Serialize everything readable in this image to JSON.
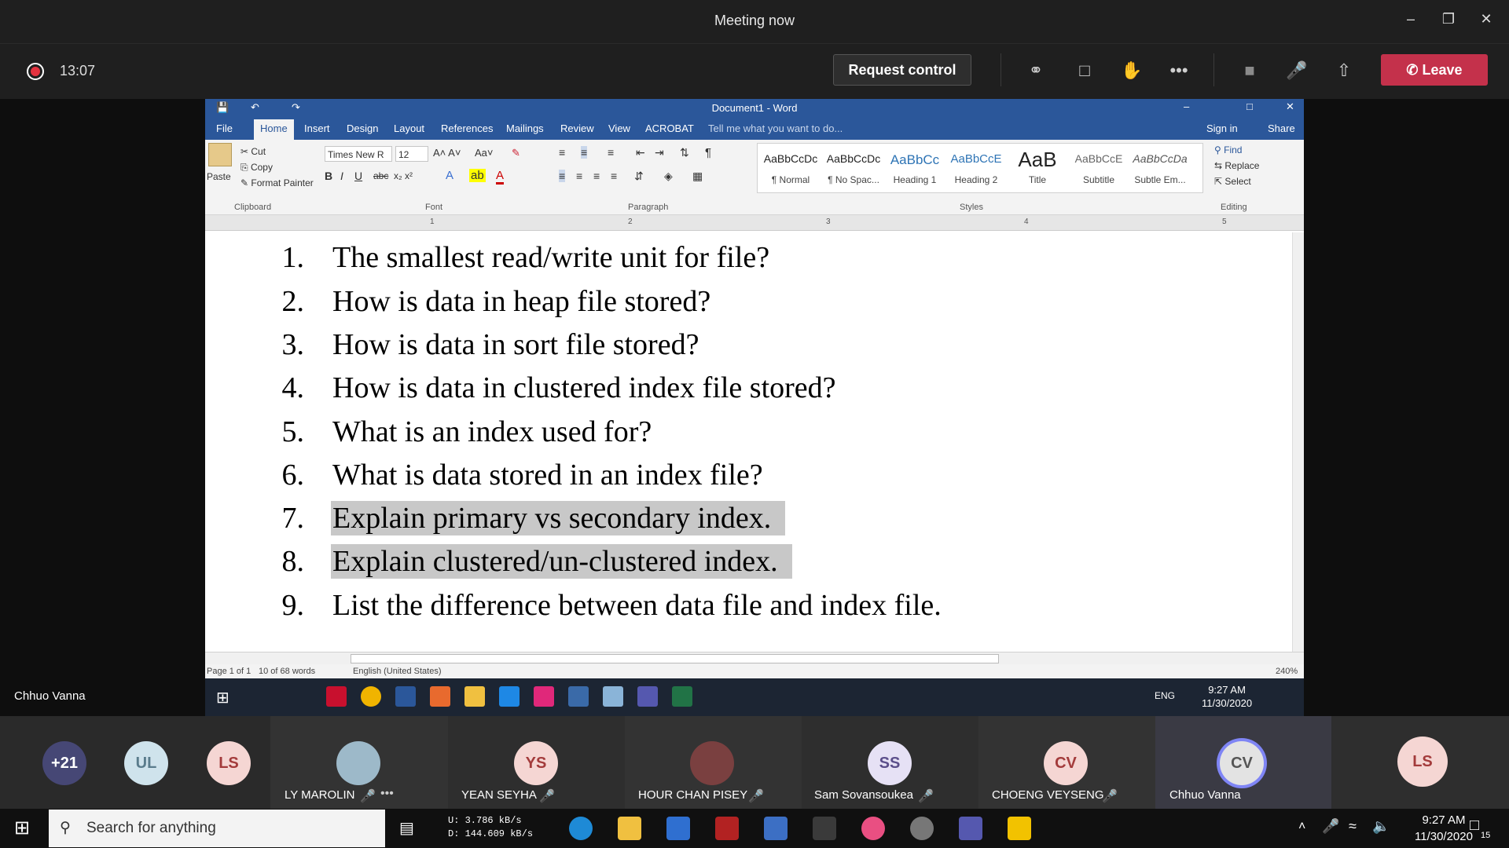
{
  "teams": {
    "window_title": "Meeting now",
    "timer": "13:07",
    "request_control": "Request control",
    "leave": "Leave",
    "presenter_label": "Chhuo Vanna"
  },
  "word": {
    "doc_title": "Document1 - Word",
    "tabs": [
      "File",
      "Home",
      "Insert",
      "Design",
      "Layout",
      "References",
      "Mailings",
      "Review",
      "View",
      "ACROBAT"
    ],
    "tell_me": "Tell me what you want to do...",
    "sign_in": "Sign in",
    "share": "Share",
    "clipboard": {
      "paste": "Paste",
      "cut": "Cut",
      "copy": "Copy",
      "format_painter": "Format Painter",
      "label": "Clipboard"
    },
    "font": {
      "name": "Times New R",
      "size": "12",
      "label": "Font"
    },
    "paragraph_label": "Paragraph",
    "styles": [
      {
        "preview": "AaBbCcDc",
        "name": "¶ Normal"
      },
      {
        "preview": "AaBbCcDc",
        "name": "¶ No Spac..."
      },
      {
        "preview": "AaBbCc",
        "name": "Heading 1"
      },
      {
        "preview": "AaBbCcE",
        "name": "Heading 2"
      },
      {
        "preview": "AaB",
        "name": "Title"
      },
      {
        "preview": "AaBbCcE",
        "name": "Subtitle"
      },
      {
        "preview": "AaBbCcDa",
        "name": "Subtle Em..."
      }
    ],
    "styles_label": "Styles",
    "editing": {
      "find": "Find",
      "replace": "Replace",
      "select": "Select",
      "label": "Editing"
    },
    "ruler_numbers": [
      "1",
      "2",
      "3",
      "4",
      "5"
    ],
    "questions": [
      {
        "num": "1.",
        "text": "The smallest read/write unit for file?",
        "highlighted": false
      },
      {
        "num": "2.",
        "text": "How is data in heap file stored?",
        "highlighted": false
      },
      {
        "num": "3.",
        "text": "How is data in sort file stored?",
        "highlighted": false
      },
      {
        "num": "4.",
        "text": "How is data in clustered index file stored?",
        "highlighted": false
      },
      {
        "num": "5.",
        "text": "What is an index used for?",
        "highlighted": false
      },
      {
        "num": "6.",
        "text": "What is data stored in an index file?",
        "highlighted": false
      },
      {
        "num": "7.",
        "text": "Explain primary vs secondary index.",
        "highlighted": true
      },
      {
        "num": "8.",
        "text": "Explain clustered/un-clustered index.",
        "highlighted": true
      },
      {
        "num": "9.",
        "text": "List the difference between data file and index file.",
        "highlighted": false
      }
    ],
    "status": {
      "page": "Page 1 of 1",
      "words": "10 of 68 words",
      "language": "English (United States)",
      "zoom": "240%"
    },
    "inner_taskbar": {
      "lang": "ENG",
      "time": "9:27 AM",
      "date": "11/30/2020"
    }
  },
  "participants": [
    {
      "initials": "+21",
      "name": "",
      "color": "#464775"
    },
    {
      "initials": "UL",
      "name": "",
      "color": "#cfe3ec"
    },
    {
      "initials": "LS",
      "name": "",
      "color": "#f5d6d3"
    },
    {
      "initials": "",
      "name": "LY MAROLIN",
      "color": "#9db9c9",
      "photo": true
    },
    {
      "initials": "YS",
      "name": "YEAN SEYHA",
      "color": "#f5d6d3"
    },
    {
      "initials": "",
      "name": "HOUR CHAN PISEY",
      "color": "#7a4040",
      "photo": true
    },
    {
      "initials": "SS",
      "name": "Sam Sovansoukea",
      "color": "#e6e1f5"
    },
    {
      "initials": "CV",
      "name": "CHOENG VEYSENG",
      "color": "#f5d6d3"
    },
    {
      "initials": "CV",
      "name": "Chhuo Vanna",
      "color": "#e3e3e3",
      "active": true
    },
    {
      "initials": "LS",
      "name": "",
      "color": "#f5d6d3"
    }
  ],
  "taskbar": {
    "search_placeholder": "Search for anything",
    "net_up": "U:      3.786 kB/s",
    "net_down": "D:   144.609 kB/s",
    "time": "9:27 AM",
    "date": "11/30/2020",
    "notif_count": "15"
  }
}
